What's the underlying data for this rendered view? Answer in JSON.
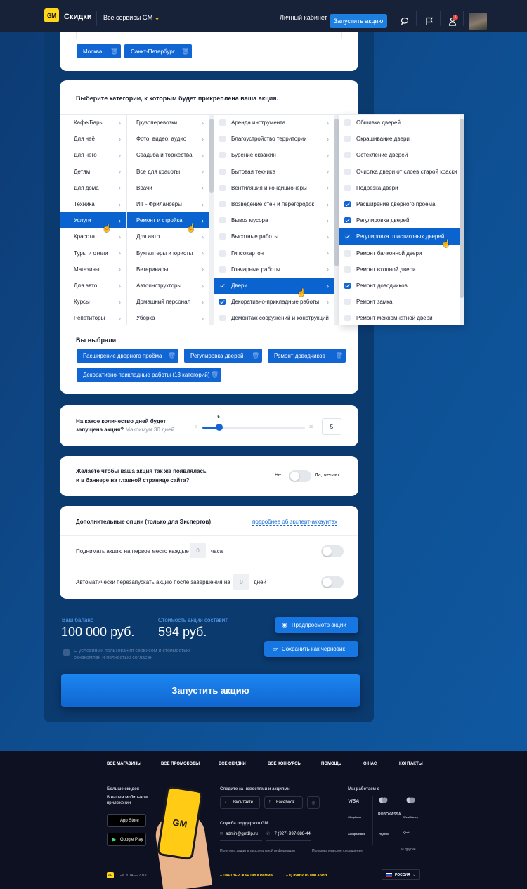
{
  "header": {
    "logo": "GM",
    "brand": "Скидки",
    "services": "Все сервисы GM",
    "cabinet": "Личный кабинет",
    "launch": "Запустить акцию",
    "notif_count": "5"
  },
  "cities": {
    "items": [
      "Москва",
      "Санкт-Петербург"
    ]
  },
  "categories": {
    "title": "Выберите категории, к которым будет прикреплена ваша акция.",
    "col1": [
      "Кафе/Бары",
      "Для неё",
      "Для него",
      "Детям",
      "Для дома",
      "Техника",
      "Услуги",
      "Красота",
      "Туры и отели",
      "Магазины",
      "Для авто",
      "Курсы",
      "Репетиторы"
    ],
    "col2": [
      "Грузоперевозки",
      "Фото, видео, аудио",
      "Свадьба и торжества",
      "Все для красоты",
      "Врачи",
      "ИТ - Фрилансеры",
      "Ремонт и стройка",
      "Для авто",
      "Бухгалтеры и юристы",
      "Ветеринары",
      "Автоинструкторы",
      "Домашний персонал",
      "Уборка"
    ],
    "col3": [
      "Аренда инструмента",
      "Благоустройство территории",
      "Бурение скважин",
      "Бытовая техника",
      "Вентиляция и кондиционеры",
      "Возведение стен и перегородок",
      "Вывоз мусора",
      "Высотные работы",
      "Гипсокартон",
      "Гончарные работы",
      "Двери",
      "Декоративно-прикладные работы",
      "Демонтаж сооружений и конструкций"
    ],
    "col4": [
      "Обшивка дверей",
      "Окрашивание двери",
      "Остекление дверей",
      "Очистка двери от слоев старой краски",
      "Подрезка двери",
      "Расширение дверного проёма",
      "Регулировка дверей",
      "Регулировка пластиковых дверей",
      "Ремонт балконной двери",
      "Ремонт входной двери",
      "Ремонт доводчиков",
      "Ремонт замка",
      "Ремонт межкомнатной двери"
    ]
  },
  "selected": {
    "title": "Вы выбрали",
    "chips": [
      "Расширение дверного проёма",
      "Регулировка дверей",
      "Ремонт доводчиков",
      "Декоративно-прикладные работы (13 категорий)"
    ]
  },
  "duration": {
    "q1": "На какое количество дней будет",
    "q2": "запущена акция?",
    "hint": "Максимум 30 дней.",
    "min": "0",
    "max": "30",
    "value": "5",
    "value_fraction": 0.167
  },
  "banner": {
    "q1": "Желаете чтобы ваша акция так же появлялась",
    "q2": "и в баннере на главной странице сайта?",
    "no": "Нет",
    "yes": "Да, желаю"
  },
  "options": {
    "title": "Дополнительные опции (только для Экспертов)",
    "link": "подробнее об эксперт-аккаунтах",
    "row1_pre": "Поднимать акцию на первое место каждые",
    "row1_val": "0",
    "row1_post": "часа",
    "row2_pre": "Автоматически перезапускать акцию после завершения на",
    "row2_val": "0",
    "row2_post": "дней"
  },
  "summary": {
    "balance_label": "Ваш баланс",
    "balance": "100 000 руб.",
    "cost_label": "Стоимость акции составит",
    "cost": "594 руб.",
    "terms": "С условиями пользования сервисом и стоимостью ознакомлен и полностью согласен",
    "preview": "Предпросмотр акции",
    "draft": "Сохранить как черновик",
    "launch": "Запустить акцию"
  },
  "footer": {
    "nav": [
      "ВСЕ МАГАЗИНЫ",
      "ВСЕ ПРОМОКОДЫ",
      "ВСЕ СКИДКИ",
      "ВСЕ КОНКУРСЫ",
      "ПОМОЩЬ",
      "О НАС",
      "КОНТАКТЫ"
    ],
    "more_title": "Больше скидок",
    "more_text": "В нашем мобильном приложении",
    "appstore": "App Store",
    "googleplay": "Google Play",
    "news_title": "Следите за новостями и акциями",
    "vk": "Вконтакте",
    "fb": "Facebook",
    "support_title": "Служба поддержки GM",
    "email": "admin@gm1lp.ru",
    "phone": "+7 (927) 997-888-44",
    "policy": "Политика защиты персональной информации",
    "agreement": "Пользовательское соглашение",
    "partners_title": "Мы работаем с",
    "partners": [
      "VISA",
      "Mastercard",
      "Mastercard",
      "Сбербанк",
      "ROBOKASSA",
      "WebMoney",
      "Альфа-Банк",
      "Яндекс",
      "Qiwi"
    ],
    "others": "И другие",
    "copyright": "GM 2014 — 2019",
    "partner_program": "+ ПАРТНЕРСКАЯ ПРОГРАММА",
    "add_shop": "+ ДОБАВИТЬ МАГАЗИН",
    "country": "РОССИЯ",
    "phone_logo": "GM"
  }
}
